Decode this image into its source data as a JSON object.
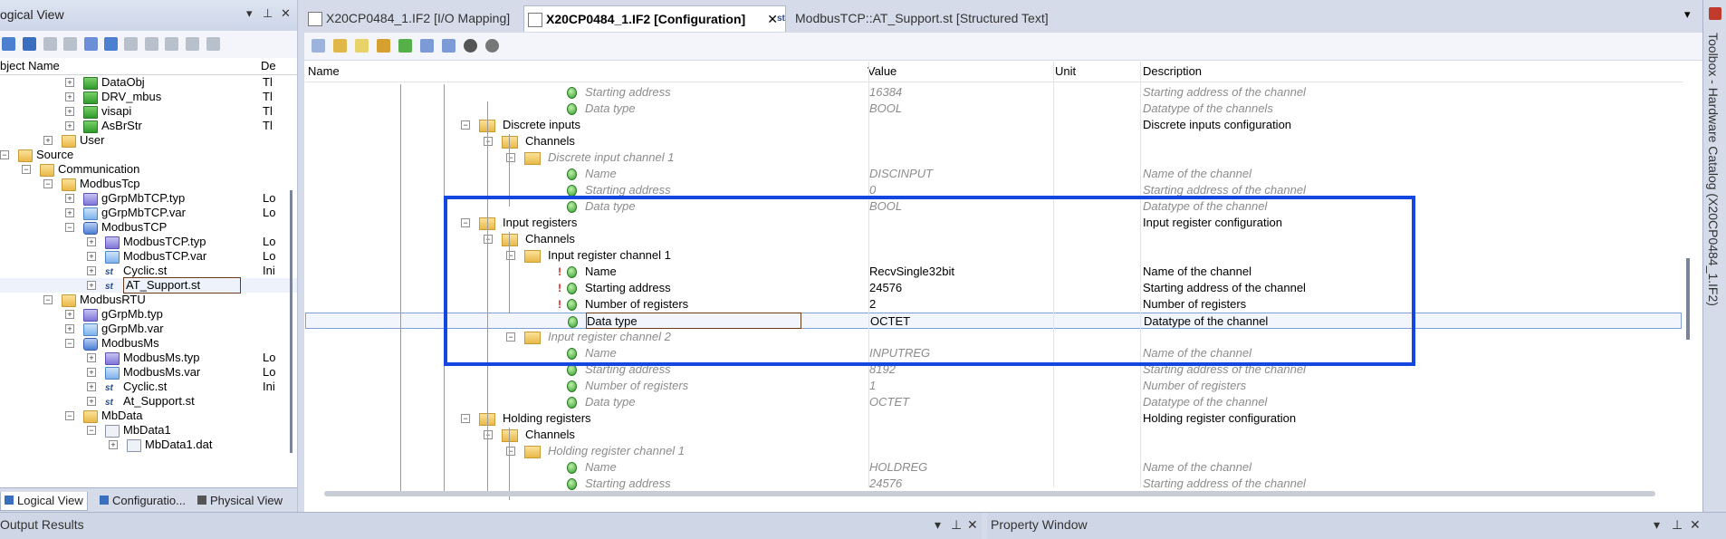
{
  "left_panel": {
    "title": "ogical View",
    "header_col1": "bject Name",
    "header_col2": "De",
    "tree": [
      {
        "label": "DataObj",
        "desc": "Tl"
      },
      {
        "label": "DRV_mbus",
        "desc": "Tl"
      },
      {
        "label": "visapi",
        "desc": "Tl"
      },
      {
        "label": "AsBrStr",
        "desc": "Tl"
      },
      {
        "label": "User",
        "desc": ""
      },
      {
        "label": "Source",
        "desc": ""
      },
      {
        "label": "Communication",
        "desc": ""
      },
      {
        "label": "ModbusTcp",
        "desc": ""
      },
      {
        "label": "gGrpMbTCP.typ",
        "desc": "Lo"
      },
      {
        "label": "gGrpMbTCP.var",
        "desc": "Lo"
      },
      {
        "label": "ModbusTCP",
        "desc": ""
      },
      {
        "label": "ModbusTCP.typ",
        "desc": "Lo"
      },
      {
        "label": "ModbusTCP.var",
        "desc": "Lo"
      },
      {
        "label": "Cyclic.st",
        "desc": "Ini"
      },
      {
        "label": "AT_Support.st",
        "desc": ""
      },
      {
        "label": "ModbusRTU",
        "desc": ""
      },
      {
        "label": "gGrpMb.typ",
        "desc": ""
      },
      {
        "label": "gGrpMb.var",
        "desc": ""
      },
      {
        "label": "ModbusMs",
        "desc": ""
      },
      {
        "label": "ModbusMs.typ",
        "desc": "Lo"
      },
      {
        "label": "ModbusMs.var",
        "desc": "Lo"
      },
      {
        "label": "Cyclic.st",
        "desc": "Ini"
      },
      {
        "label": "At_Support.st",
        "desc": ""
      },
      {
        "label": "MbData",
        "desc": ""
      },
      {
        "label": "MbData1",
        "desc": ""
      },
      {
        "label": "MbData1.dat",
        "desc": ""
      }
    ],
    "bottom_tabs": [
      "Logical View",
      "Configuratio...",
      "Physical View"
    ]
  },
  "editor": {
    "tabs": [
      "X20CP0484_1.IF2 [I/O Mapping]",
      "X20CP0484_1.IF2 [Configuration]",
      "ModbusTCP::AT_Support.st [Structured Text]"
    ],
    "columns": [
      "Name",
      "Value",
      "Unit",
      "Description"
    ],
    "rows": [
      {
        "name": "Starting address",
        "value": "16384",
        "desc": "Starting address of the channel"
      },
      {
        "name": "Data type",
        "value": "BOOL",
        "desc": "Datatype of the channels"
      },
      {
        "name": "Discrete inputs",
        "value": "",
        "desc": "Discrete inputs configuration"
      },
      {
        "name": "Channels",
        "value": "",
        "desc": ""
      },
      {
        "name": "Discrete input channel 1",
        "value": "",
        "desc": ""
      },
      {
        "name": "Name",
        "value": "DISCINPUT",
        "desc": "Name of the channel"
      },
      {
        "name": "Starting address",
        "value": "0",
        "desc": "Starting address of the channel"
      },
      {
        "name": "Data type",
        "value": "BOOL",
        "desc": "Datatype of the channel"
      },
      {
        "name": "Input registers",
        "value": "",
        "desc": "Input register configuration"
      },
      {
        "name": "Channels",
        "value": "",
        "desc": ""
      },
      {
        "name": "Input register channel 1",
        "value": "",
        "desc": ""
      },
      {
        "name": "Name",
        "value": "RecvSingle32bit",
        "desc": "Name of the channel"
      },
      {
        "name": "Starting address",
        "value": "24576",
        "desc": "Starting address of the channel"
      },
      {
        "name": "Number of registers",
        "value": "2",
        "desc": "Number of registers"
      },
      {
        "name": "Data type",
        "value": "OCTET",
        "desc": "Datatype of the channel"
      },
      {
        "name": "Input register channel 2",
        "value": "",
        "desc": ""
      },
      {
        "name": "Name",
        "value": "INPUTREG",
        "desc": "Name of the channel"
      },
      {
        "name": "Starting address",
        "value": "8192",
        "desc": "Starting address of the channel"
      },
      {
        "name": "Number of registers",
        "value": "1",
        "desc": "Number of registers"
      },
      {
        "name": "Data type",
        "value": "OCTET",
        "desc": "Datatype of the channel"
      },
      {
        "name": "Holding registers",
        "value": "",
        "desc": "Holding register configuration"
      },
      {
        "name": "Channels",
        "value": "",
        "desc": ""
      },
      {
        "name": "Holding register channel 1",
        "value": "",
        "desc": ""
      },
      {
        "name": "Name",
        "value": "HOLDREG",
        "desc": "Name of the channel"
      },
      {
        "name": "Starting address",
        "value": "24576",
        "desc": "Starting address of the channel"
      }
    ]
  },
  "toolbox_label": "Toolbox - Hardware Catalog (X20CP0484_1.IF2)",
  "bottom": {
    "output_title": "Output Results",
    "property_title": "Property Window"
  },
  "colors": {
    "highlight_box": "#1446e0",
    "panel_bg": "#d6dbe9"
  }
}
